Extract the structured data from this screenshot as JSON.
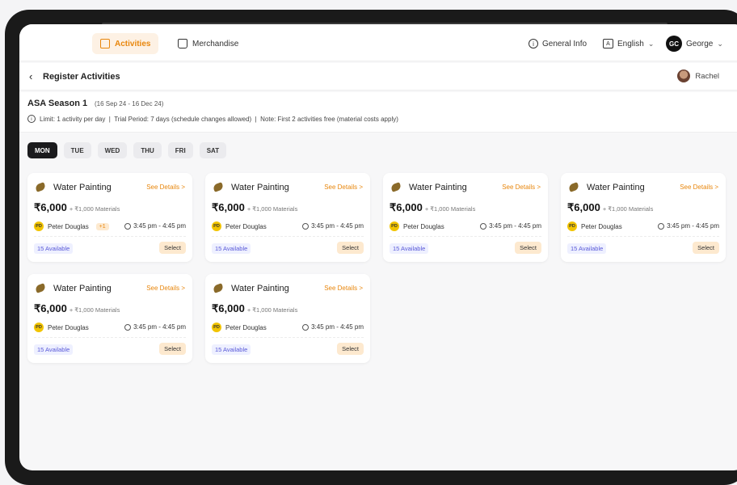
{
  "nav": {
    "tabs": [
      {
        "label": "Activities",
        "icon": "clipboard-icon"
      },
      {
        "label": "Merchandise",
        "icon": "bag-icon"
      }
    ],
    "general_info": "General Info",
    "language": "English",
    "user_initials": "GC",
    "user_name": "George"
  },
  "subheader": {
    "title": "Register Activities",
    "child_name": "Rachel"
  },
  "season": {
    "name": "ASA Season 1",
    "dates": "(16 Sep 24 - 16 Dec 24)",
    "info": "Limit: 1 activity per day  |  Trial Period: 7 days (schedule changes allowed)  |  Note: First 2 activities free (material costs apply)"
  },
  "days": [
    "MON",
    "TUE",
    "WED",
    "THU",
    "FRI",
    "SAT"
  ],
  "selected_day": "MON",
  "colors": {
    "accent": "#e8860c",
    "accent_bg": "#fdf1e4",
    "available": "#5a5ad8"
  },
  "activities": [
    {
      "title": "Water Painting",
      "see_details": "See Details >",
      "price": "₹6,000",
      "materials": "+ ₹1,000 Materials",
      "instructor_initials": "PD",
      "instructor": "Peter Douglas",
      "extra": "+1",
      "time": "3:45 pm - 4:45 pm",
      "available": "15 Available",
      "select": "Select"
    },
    {
      "title": "Water Painting",
      "see_details": "See Details >",
      "price": "₹6,000",
      "materials": "+ ₹1,000 Materials",
      "instructor_initials": "PD",
      "instructor": "Peter Douglas",
      "extra": "",
      "time": "3:45 pm - 4:45 pm",
      "available": "15 Available",
      "select": "Select"
    },
    {
      "title": "Water Painting",
      "see_details": "See Details >",
      "price": "₹6,000",
      "materials": "+ ₹1,000 Materials",
      "instructor_initials": "PD",
      "instructor": "Peter Douglas",
      "extra": "",
      "time": "3:45 pm - 4:45 pm",
      "available": "15 Available",
      "select": "Select"
    },
    {
      "title": "Water Painting",
      "see_details": "See Details >",
      "price": "₹6,000",
      "materials": "+ ₹1,000 Materials",
      "instructor_initials": "PD",
      "instructor": "Peter Douglas",
      "extra": "",
      "time": "3:45 pm - 4:45 pm",
      "available": "15 Available",
      "select": "Select"
    },
    {
      "title": "Water Painting",
      "see_details": "See Details >",
      "price": "₹6,000",
      "materials": "+ ₹1,000 Materials",
      "instructor_initials": "PD",
      "instructor": "Peter Douglas",
      "extra": "",
      "time": "3:45 pm - 4:45 pm",
      "available": "15 Available",
      "select": "Select"
    },
    {
      "title": "Water Painting",
      "see_details": "See Details >",
      "price": "₹6,000",
      "materials": "+ ₹1,000 Materials",
      "instructor_initials": "PD",
      "instructor": "Peter Douglas",
      "extra": "",
      "time": "3:45 pm - 4:45 pm",
      "available": "15 Available",
      "select": "Select"
    }
  ]
}
